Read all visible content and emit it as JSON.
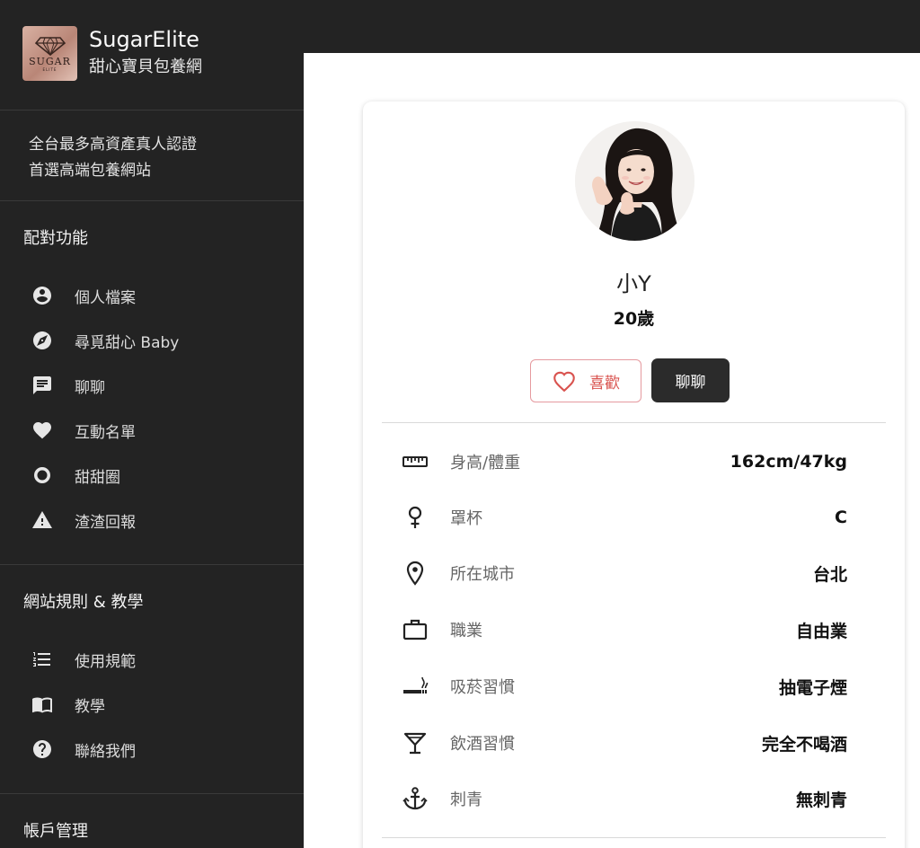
{
  "brand": {
    "name": "SugarElite",
    "subtitle": "甜心寶貝包養網",
    "logo_word": "SUGAR",
    "logo_sub": "ELITE"
  },
  "tagline": {
    "line1": "全台最多高資產真人認證",
    "line2": "首選高端包養網站"
  },
  "sections": {
    "matching": {
      "title": "配對功能",
      "items": [
        {
          "label": "個人檔案",
          "icon": "account-circle-icon"
        },
        {
          "label": "尋覓甜心 Baby",
          "icon": "compass-icon"
        },
        {
          "label": "聊聊",
          "icon": "chat-icon"
        },
        {
          "label": "互動名單",
          "icon": "heart-icon"
        },
        {
          "label": "甜甜圈",
          "icon": "ring-icon"
        },
        {
          "label": "渣渣回報",
          "icon": "warning-icon"
        }
      ]
    },
    "rules": {
      "title": "網站規則 & 教學",
      "items": [
        {
          "label": "使用規範",
          "icon": "numbered-list-icon"
        },
        {
          "label": "教學",
          "icon": "book-icon"
        },
        {
          "label": "聯絡我們",
          "icon": "help-icon"
        }
      ]
    },
    "account": {
      "title": "帳戶管理"
    }
  },
  "profile": {
    "name": "小Y",
    "age": "20歲",
    "like_label": "喜歡",
    "chat_label": "聊聊",
    "details": [
      {
        "icon": "ruler-icon",
        "label": "身高/體重",
        "value": "162cm/47kg"
      },
      {
        "icon": "female-icon",
        "label": "罩杯",
        "value": "C"
      },
      {
        "icon": "location-pin-icon",
        "label": "所在城市",
        "value": "台北"
      },
      {
        "icon": "briefcase-icon",
        "label": "職業",
        "value": "自由業"
      },
      {
        "icon": "smoking-icon",
        "label": "吸菸習慣",
        "value": "抽電子煙"
      },
      {
        "icon": "cocktail-icon",
        "label": "飲酒習慣",
        "value": "完全不喝酒"
      },
      {
        "icon": "anchor-icon",
        "label": "刺青",
        "value": "無刺青"
      }
    ]
  },
  "colors": {
    "sidebar_bg": "#232323",
    "like_accent": "#d9534f",
    "chat_btn_bg": "#2b2b2b"
  }
}
